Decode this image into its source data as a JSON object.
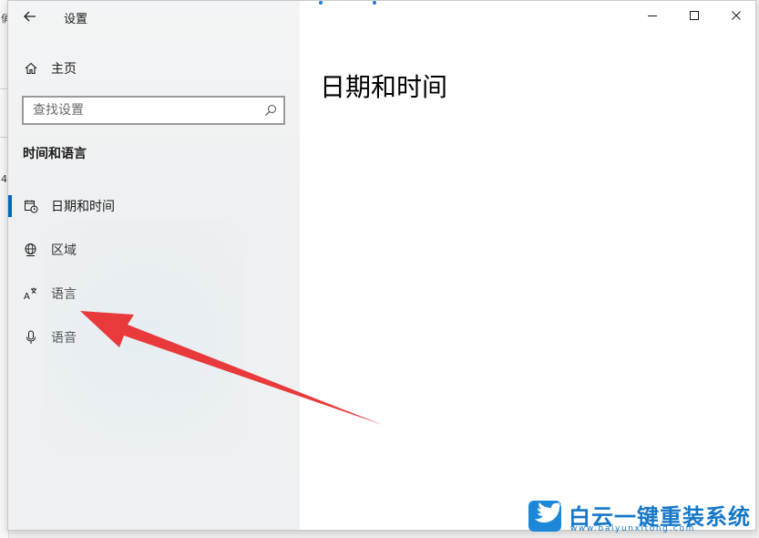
{
  "window": {
    "app_title": "设置",
    "caption_buttons": [
      "minimize",
      "maximize",
      "close"
    ]
  },
  "sidebar": {
    "home_label": "主页",
    "search": {
      "placeholder": "查找设置",
      "value": ""
    },
    "section_title": "时间和语言",
    "items": [
      {
        "label": "日期和时间",
        "icon": "calendar-clock-icon",
        "selected": true
      },
      {
        "label": "区域",
        "icon": "globe-region-icon",
        "selected": false
      },
      {
        "label": "语言",
        "icon": "language-icon",
        "selected": false
      },
      {
        "label": "语音",
        "icon": "microphone-icon",
        "selected": false
      }
    ]
  },
  "content": {
    "page_title": "日期和时间"
  },
  "background_window": {
    "glyphs": [
      "俏",
      "4"
    ]
  },
  "annotation": {
    "arrow_color": "#e8393b",
    "points_to": "语言"
  },
  "watermark": {
    "cn": "白云一键重装系统",
    "en": "www.baiyunxitong.com",
    "color": "#1677c8"
  },
  "colors": {
    "accent": "#0067c0",
    "sidebar_bg": "#f0f1f2",
    "content_bg": "#ffffff"
  }
}
